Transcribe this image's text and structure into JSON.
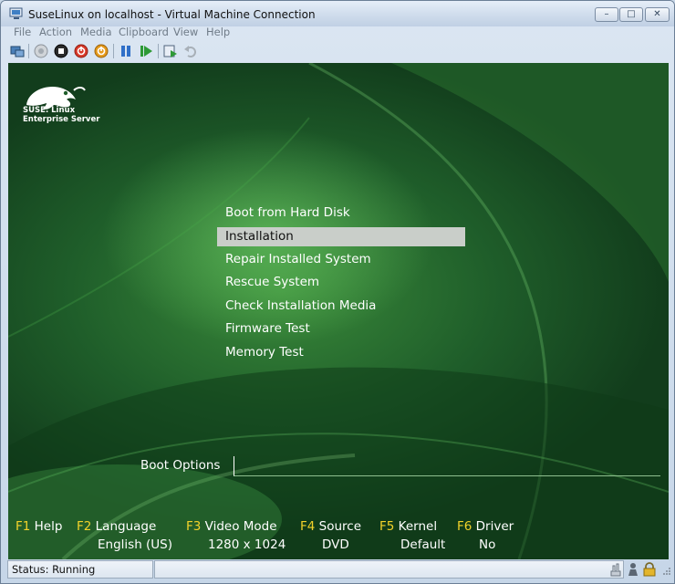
{
  "window": {
    "title": "SuseLinux on localhost - Virtual Machine Connection",
    "minimize_glyph": "–",
    "maximize_glyph": "□",
    "close_glyph": "✕"
  },
  "menubar": {
    "items": [
      "File",
      "Action",
      "Media",
      "Clipboard",
      "View",
      "Help"
    ]
  },
  "toolbar": {
    "buttons": [
      "ctrl-alt-del-icon",
      "start-icon",
      "turn-off-icon",
      "shut-down-icon",
      "save-state-icon",
      "pause-icon",
      "resume-icon",
      "snapshot-icon",
      "revert-icon"
    ]
  },
  "logo": {
    "line1": "SUSE. Linux",
    "line2": "Enterprise Server"
  },
  "boot_menu": {
    "items": [
      "Boot from Hard Disk",
      "Installation",
      "Repair Installed System",
      "Rescue System",
      "Check Installation Media",
      "Firmware Test",
      "Memory Test"
    ],
    "selected_index": 1
  },
  "boot_options": {
    "label": "Boot Options",
    "value": ""
  },
  "function_keys": [
    {
      "key": "F1",
      "label": "Help",
      "value": ""
    },
    {
      "key": "F2",
      "label": "Language",
      "value": "English (US)"
    },
    {
      "key": "F3",
      "label": "Video Mode",
      "value": "1280 x 1024"
    },
    {
      "key": "F4",
      "label": "Source",
      "value": "DVD"
    },
    {
      "key": "F5",
      "label": "Kernel",
      "value": "Default"
    },
    {
      "key": "F6",
      "label": "Driver",
      "value": "No"
    }
  ],
  "colors": {
    "fkey_accent": "#f2d22a",
    "selected_bg": "#c9cec9",
    "screen_green": "#1f5e2a"
  },
  "status": {
    "text": "Status: Running"
  }
}
